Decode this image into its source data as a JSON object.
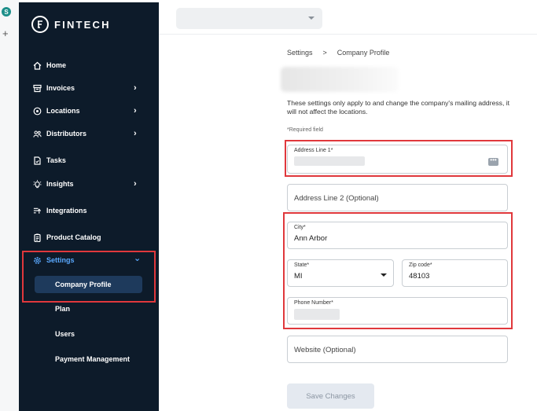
{
  "rail": {
    "badge": "S",
    "plus": "+"
  },
  "brand": {
    "name": "FINTECH"
  },
  "nav": {
    "home": "Home",
    "invoices": "Invoices",
    "locations": "Locations",
    "distributors": "Distributors",
    "tasks": "Tasks",
    "insights": "Insights",
    "integrations": "Integrations",
    "product_catalog": "Product Catalog",
    "settings": "Settings",
    "chevron_right": "›",
    "chevron_down": "⌄"
  },
  "settings_sub": {
    "company_profile": "Company Profile",
    "plan": "Plan",
    "users": "Users",
    "payment_management": "Payment Management"
  },
  "breadcrumb": {
    "root": "Settings",
    "sep": ">",
    "current": "Company Profile"
  },
  "description": "These settings only apply to and change the company's mailing address, it will not affect the locations.",
  "required_note": "*Required field",
  "form": {
    "address1_label": "Address Line 1*",
    "address2_placeholder": "Address Line 2 (Optional)",
    "city_label": "City*",
    "city_value": "Ann Arbor",
    "state_label": "State*",
    "state_value": "MI",
    "zip_label": "Zip code*",
    "zip_value": "48103",
    "phone_label": "Phone Number*",
    "website_placeholder": "Website (Optional)",
    "save_label": "Save Changes"
  },
  "colors": {
    "sidebar_bg": "#0d1b2a",
    "active_accent": "#5aa9ff",
    "highlight_red": "#e0383c"
  }
}
